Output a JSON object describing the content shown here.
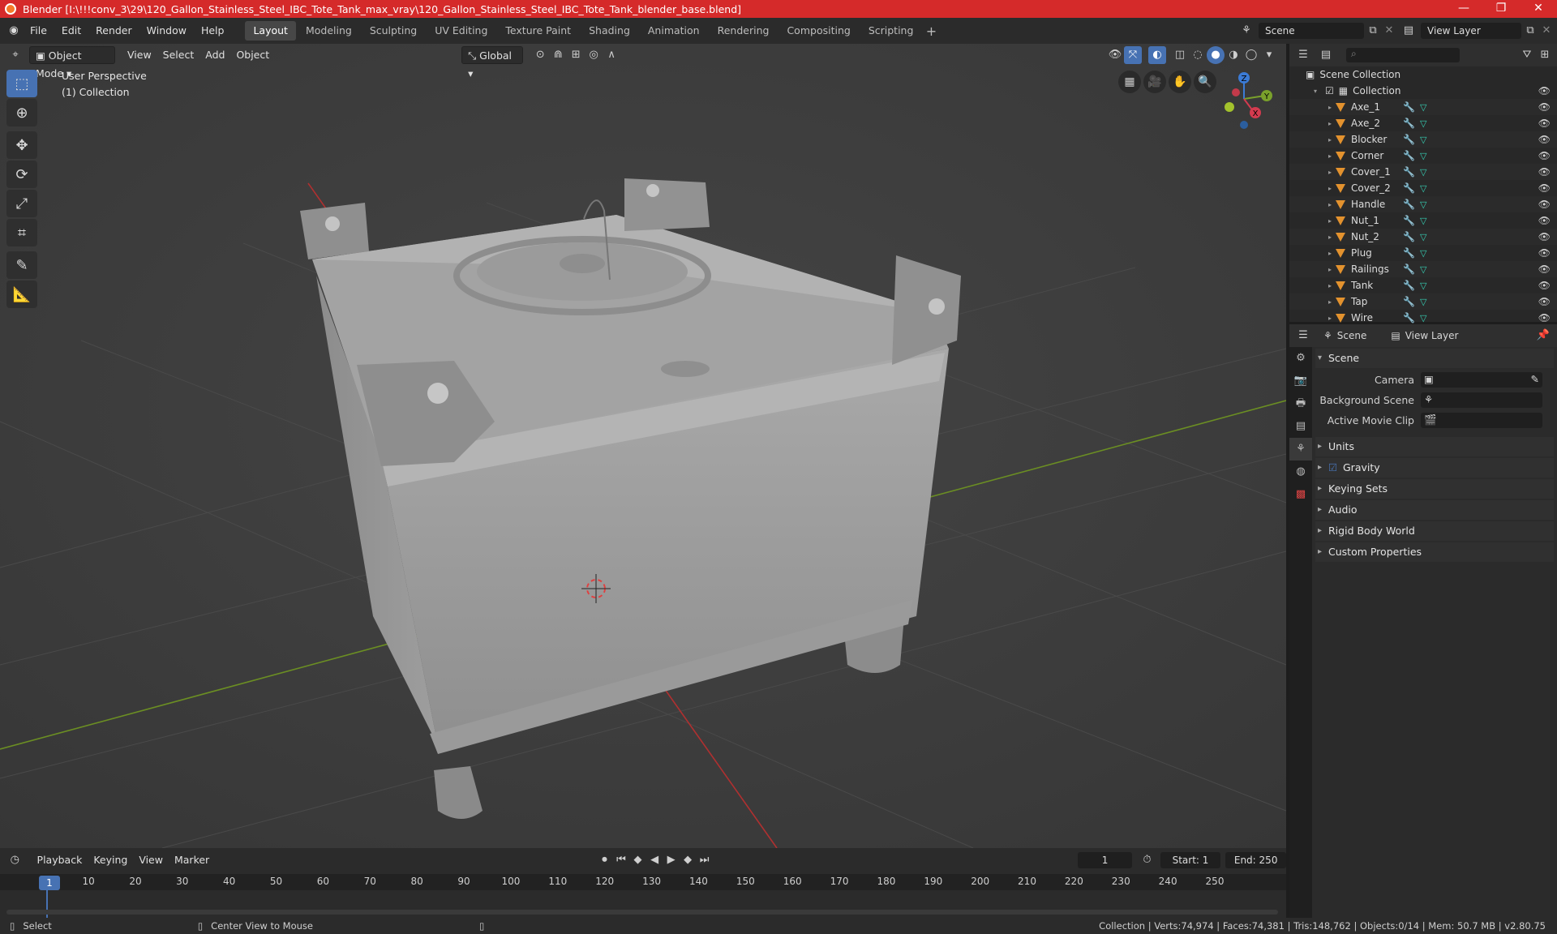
{
  "title": "Blender [I:\\!!!conv_3\\29\\120_Gallon_Stainless_Steel_IBC_Tote_Tank_max_vray\\120_Gallon_Stainless_Steel_IBC_Tote_Tank_blender_base.blend]",
  "menu": [
    "File",
    "Edit",
    "Render",
    "Window",
    "Help"
  ],
  "workspaces": [
    "Layout",
    "Modeling",
    "Sculpting",
    "UV Editing",
    "Texture Paint",
    "Shading",
    "Animation",
    "Rendering",
    "Compositing",
    "Scripting"
  ],
  "active_workspace": "Layout",
  "scene_name": "Scene",
  "view_layer": "View Layer",
  "viewport": {
    "mode": "Object Mode",
    "menus": [
      "View",
      "Select",
      "Add",
      "Object"
    ],
    "orientation": "Global",
    "perspective_label": "User Perspective",
    "collection_label": "(1) Collection"
  },
  "gizmo": {
    "x": "X",
    "y": "Y",
    "z": "Z"
  },
  "outliner": {
    "root": "Scene Collection",
    "collection": "Collection",
    "objects": [
      "Axe_1",
      "Axe_2",
      "Blocker",
      "Corner",
      "Cover_1",
      "Cover_2",
      "Handle",
      "Nut_1",
      "Nut_2",
      "Plug",
      "Railings",
      "Tank",
      "Tap",
      "Wire"
    ]
  },
  "properties": {
    "tab_scene": "Scene",
    "tab_view_layer": "View Layer",
    "panel_scene": "Scene",
    "camera_label": "Camera",
    "background_scene_label": "Background Scene",
    "active_movie_clip_label": "Active Movie Clip",
    "panels": [
      "Units",
      "Gravity",
      "Keying Sets",
      "Audio",
      "Rigid Body World",
      "Custom Properties"
    ]
  },
  "timeline": {
    "menus": [
      "Playback",
      "Keying",
      "View",
      "Marker"
    ],
    "current_frame": "1",
    "start_label": "Start:",
    "start": "1",
    "end_label": "End:",
    "end": "250",
    "ticks": [
      "1",
      "10",
      "20",
      "30",
      "40",
      "50",
      "60",
      "70",
      "80",
      "90",
      "100",
      "110",
      "120",
      "130",
      "140",
      "150",
      "160",
      "170",
      "180",
      "190",
      "200",
      "210",
      "220",
      "230",
      "240",
      "250"
    ]
  },
  "status": {
    "left": "Select",
    "middle": "Center View to Mouse",
    "right": "Collection | Verts:74,974 | Faces:74,381 | Tris:148,762 | Objects:0/14 | Mem: 50.7 MB | v2.80.75"
  },
  "colors": {
    "accent": "#4772b3",
    "title_bar": "#d52a2a",
    "mesh_orange": "#e3922e"
  }
}
